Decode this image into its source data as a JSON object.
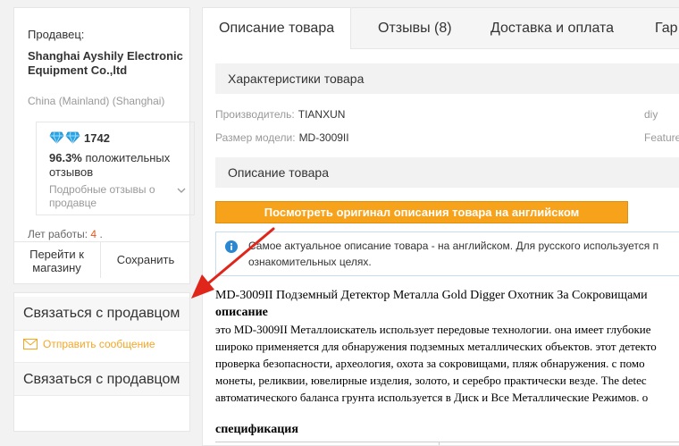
{
  "seller": {
    "label": "Продавец:",
    "name": "Shanghai Ayshily Electronic Equipment Co.,ltd",
    "location": "China (Mainland) (Shanghai)",
    "score": "1742",
    "positive_pct": "96.3%",
    "positive_text": "положительных отзывов",
    "details_link": "Подробные отзывы о продавце",
    "years_label": "Лет работы:",
    "years_value": "4",
    "years_suffix": ".",
    "go_store": "Перейти к магазину",
    "save": "Сохранить"
  },
  "contact": {
    "title_top": "Связаться с продавцом",
    "send_message": "Отправить сообщение",
    "title_bottom": "Связаться с продавцом"
  },
  "tabs": [
    {
      "label": "Описание товара",
      "active": true
    },
    {
      "label": "Отзывы (8)",
      "active": false
    },
    {
      "label": "Доставка и оплата",
      "active": false
    },
    {
      "label": "Гар",
      "active": false
    }
  ],
  "characteristics": {
    "title": "Характеристики товара",
    "rows": [
      {
        "label": "Производитель:",
        "value": "TIANXUN",
        "right": "diy"
      },
      {
        "label": "Размер модели:",
        "value": "MD-3009II",
        "right": "Feature"
      }
    ]
  },
  "description": {
    "title": "Описание товара",
    "original_button": "Посмотреть оригинал описания товара на английском",
    "notice_line1": "Самое актуальное описание товара - на английском. Для русского используется п",
    "notice_line2": "ознакомительных целях.",
    "headline": "MD-3009II Подземный Детектор Металла Gold Digger Охотник За Сокровищами",
    "subheading": "описание",
    "lines": [
      "это MD-3009II Металлоискатель использует передовые технологии. она имеет глубокие",
      "широко применяется для обнаружения подземных металлических объектов. этот детекто",
      "проверка безопасности, археология, охота за сокровищами, пляж обнаружения. с помо",
      "монеты, реликвии, ювелирные изделия, золото, и серебро практически везде. The detec",
      "автоматического баланса грунта используется в Диск и Все Металлические Режимов. о"
    ],
    "spec_heading": "спецификация"
  },
  "colors": {
    "accent_orange": "#f7a21b",
    "arrow_red": "#e0251b",
    "years_orange": "#e5541e",
    "send_message_orange": "#f5a623",
    "diamond_blue": "#2aa7e8"
  }
}
